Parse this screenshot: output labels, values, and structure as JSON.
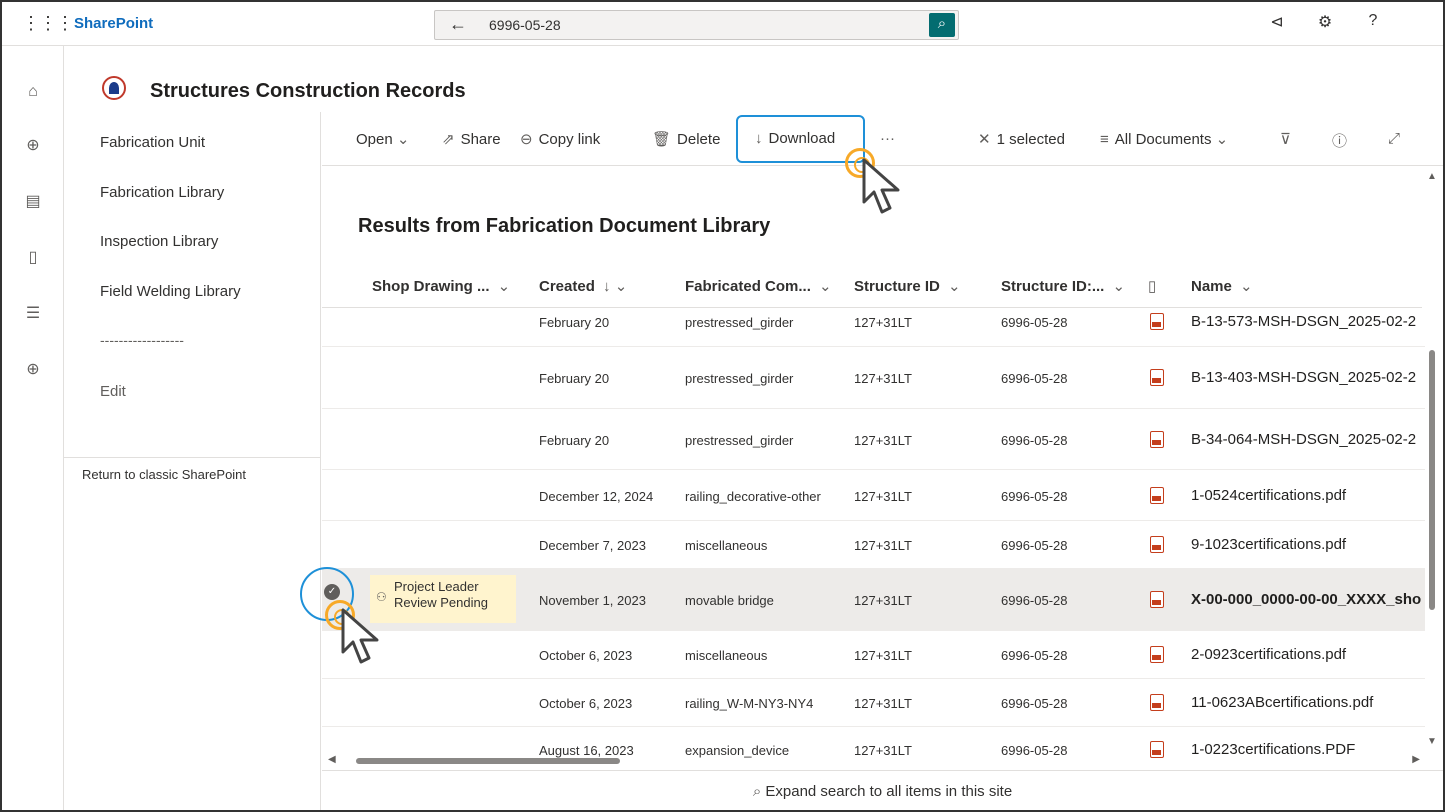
{
  "suite": {
    "brand": "SharePoint",
    "search_query": "6996-05-28"
  },
  "site": {
    "title": "Structures Construction Records"
  },
  "nav": {
    "items": [
      "Fabrication Unit",
      "Fabrication Library",
      "Inspection Library",
      "Field Welding Library"
    ],
    "separator": "------------------",
    "edit": "Edit",
    "classic": "Return to classic SharePoint"
  },
  "commands": {
    "open": "Open",
    "share": "Share",
    "copy_link": "Copy link",
    "delete": "Delete",
    "download": "Download",
    "more": "···",
    "selected": "1 selected",
    "view": "All Documents"
  },
  "results_title": "Results from Fabrication Document Library",
  "columns": {
    "shop": "Shop Drawing ...",
    "created": "Created",
    "fabricated": "Fabricated Com...",
    "structure_id": "Structure ID",
    "structure_id2": "Structure ID:...",
    "name": "Name"
  },
  "rows": [
    {
      "created": "February 20",
      "fabricated": "prestressed_girder",
      "sid": "127+31LT",
      "sid2": "6996-05-28",
      "name": "B-13-573-MSH-DSGN_2025-02-2"
    },
    {
      "created": "February 20",
      "fabricated": "prestressed_girder",
      "sid": "127+31LT",
      "sid2": "6996-05-28",
      "name": "B-13-403-MSH-DSGN_2025-02-2"
    },
    {
      "created": "February 20",
      "fabricated": "prestressed_girder",
      "sid": "127+31LT",
      "sid2": "6996-05-28",
      "name": "B-34-064-MSH-DSGN_2025-02-2"
    },
    {
      "created": "December 12, 2024",
      "fabricated": "railing_decorative-other",
      "sid": "127+31LT",
      "sid2": "6996-05-28",
      "name": "1-0524certifications.pdf"
    },
    {
      "created": "December 7, 2023",
      "fabricated": "miscellaneous",
      "sid": "127+31LT",
      "sid2": "6996-05-28",
      "name": "9-1023certifications.pdf"
    },
    {
      "status_line1": "Project Leader",
      "status_line2": "Review Pending",
      "created": "November 1, 2023",
      "fabricated": "movable bridge",
      "sid": "127+31LT",
      "sid2": "6996-05-28",
      "name": "X-00-000_0000-00-00_XXXX_sho"
    },
    {
      "created": "October 6, 2023",
      "fabricated": "miscellaneous",
      "sid": "127+31LT",
      "sid2": "6996-05-28",
      "name": "2-0923certifications.pdf"
    },
    {
      "created": "October 6, 2023",
      "fabricated": "railing_W-M-NY3-NY4",
      "sid": "127+31LT",
      "sid2": "6996-05-28",
      "name": "11-0623ABcertifications.pdf"
    },
    {
      "created": "August 16, 2023",
      "fabricated": "expansion_device",
      "sid": "127+31LT",
      "sid2": "6996-05-28",
      "name": "1-0223certifications.PDF"
    }
  ],
  "footer": "Expand search to all items in this site"
}
